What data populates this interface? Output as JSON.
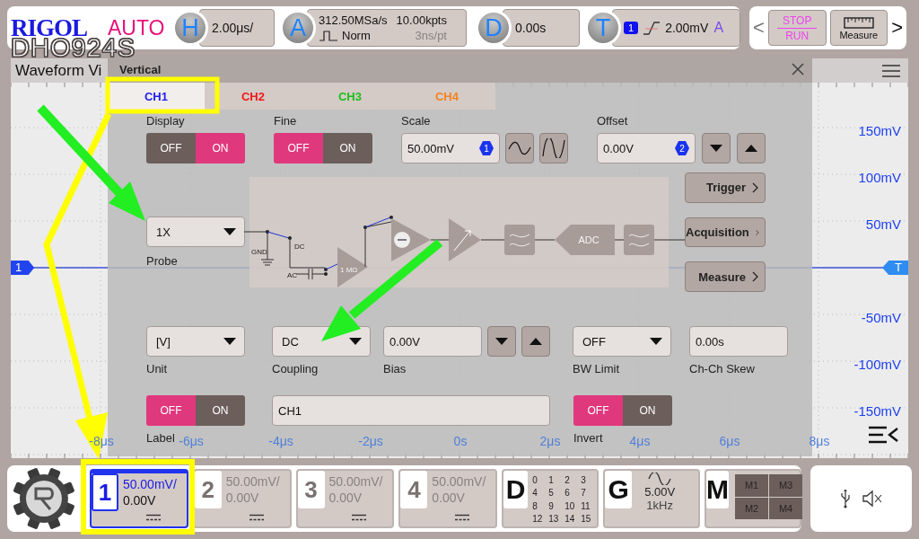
{
  "brand": {
    "logo": "RIGOL",
    "mode": "AUTO",
    "model": "DHO924S"
  },
  "top_bar": {
    "horizontal": {
      "key": "H",
      "scale": "2.00μs/"
    },
    "acquisition": {
      "key": "A",
      "sample_rate": "312.50MSa/s",
      "memory_depth": "10.00kpts",
      "mode": "Norm",
      "resolution": "3ns/pt"
    },
    "delay": {
      "key": "D",
      "value": "0.00s"
    },
    "trigger": {
      "key": "T",
      "source": "1",
      "level": "2.00mV",
      "sweep": "A"
    },
    "quick": {
      "prev": "<",
      "stop": "STOP",
      "run": "RUN",
      "measure": "Measure",
      "next": ">"
    }
  },
  "waveform_view": {
    "title": "Waveform Vi",
    "channel_marker": "1",
    "trigger_marker": "T",
    "y_labels": [
      "150mV",
      "100mV",
      "50mV",
      "-50mV",
      "-100mV",
      "-150mV"
    ],
    "x_labels": [
      "-8μs",
      "-6μs",
      "-4μs",
      "-2μs",
      "0s",
      "2μs",
      "4μs",
      "6μs",
      "8μs"
    ]
  },
  "vertical_dialog": {
    "title": "Vertical",
    "tabs": [
      {
        "label": "CH1",
        "color": "#1f1fe6",
        "selected": true
      },
      {
        "label": "CH2",
        "color": "#f01818",
        "selected": false
      },
      {
        "label": "CH3",
        "color": "#1cbf1c",
        "selected": false
      },
      {
        "label": "CH4",
        "color": "#f58220",
        "selected": false
      }
    ],
    "display": {
      "label": "Display",
      "off_text": "OFF",
      "on_text": "ON",
      "on": true
    },
    "fine": {
      "label": "Fine",
      "off_text": "OFF",
      "on_text": "ON",
      "on": false
    },
    "scale": {
      "label": "Scale",
      "value": "50.00mV",
      "knob": "1"
    },
    "offset": {
      "label": "Offset",
      "value": "0.00V",
      "knob": "2"
    },
    "probe": {
      "label": "Probe",
      "value": "1X"
    },
    "diagram": {
      "gnd": "GND",
      "dc": "DC",
      "ac": "AC",
      "impedance": "1 MΩ",
      "adc": "ADC"
    },
    "side_buttons": [
      "Trigger",
      "Acquisition",
      "Measure"
    ],
    "unit": {
      "label": "Unit",
      "value": "[V]"
    },
    "coupling": {
      "label": "Coupling",
      "value": "DC"
    },
    "bias": {
      "label": "Bias",
      "value": "0.00V"
    },
    "bw_limit": {
      "label": "BW Limit",
      "value": "OFF"
    },
    "skew": {
      "label": "Ch-Ch Skew",
      "value": "0.00s"
    },
    "label_switch": {
      "label": "Label",
      "off_text": "OFF",
      "on_text": "ON",
      "on": false
    },
    "channel_label": {
      "value": "CH1"
    },
    "invert": {
      "label": "Invert",
      "off_text": "OFF",
      "on_text": "ON",
      "on": false
    }
  },
  "bottom_bar": {
    "channels": [
      {
        "number": "1",
        "scale": "50.00mV/",
        "offset": "0.00V",
        "on": true
      },
      {
        "number": "2",
        "scale": "50.00mV/",
        "offset": "0.00V",
        "on": false
      },
      {
        "number": "3",
        "scale": "50.00mV/",
        "offset": "0.00V",
        "on": false
      },
      {
        "number": "4",
        "scale": "50.00mV/",
        "offset": "0.00V",
        "on": false
      }
    ],
    "digital": {
      "key": "D",
      "bits": [
        "0",
        "1",
        "2",
        "3",
        "4",
        "5",
        "6",
        "7",
        "8",
        "9",
        "10",
        "11",
        "12",
        "13",
        "14",
        "15"
      ]
    },
    "generator": {
      "key": "G",
      "amplitude": "5.00V",
      "frequency": "1kHz"
    },
    "math": {
      "key": "M",
      "slots": [
        "M1",
        "M3",
        "M2",
        "M4"
      ]
    }
  }
}
